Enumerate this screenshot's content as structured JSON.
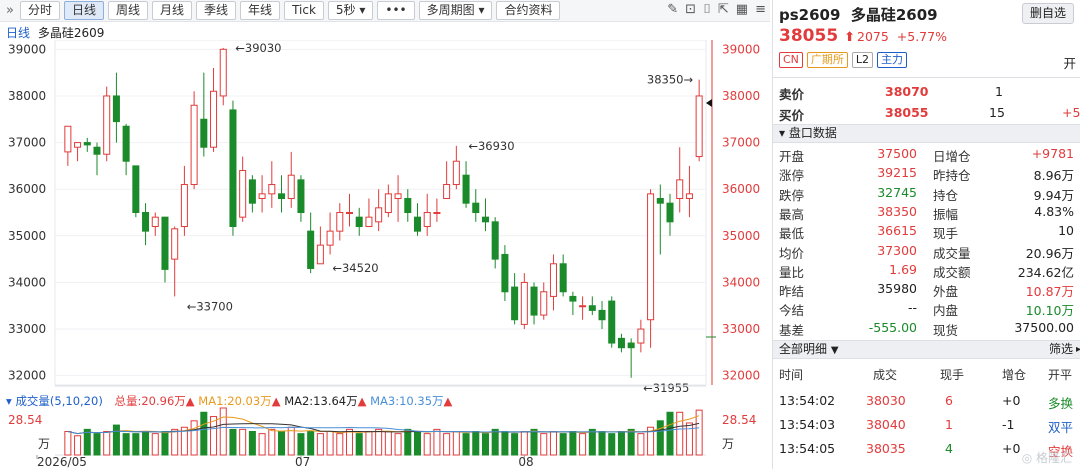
{
  "toolbar": {
    "buttons": [
      "分时",
      "日线",
      "周线",
      "月线",
      "季线",
      "年线",
      "Tick",
      "5秒 ▾",
      "•••",
      "多周期图 ▾",
      "合约资料"
    ],
    "active": 1,
    "left_icon": "collapse-icon"
  },
  "chart_header": {
    "period": "日线",
    "name": "多晶硅2609"
  },
  "chart_data": [
    {
      "type": "candlestick",
      "title": "",
      "y_ticks": [
        39000,
        38000,
        37000,
        36000,
        35000,
        34000,
        33000,
        32000
      ],
      "ylim": [
        31800,
        39200
      ],
      "x_ticks": [
        "2026/05",
        "07",
        "08"
      ],
      "up_color": "#e23b3b",
      "down_color": "#1a8a2a",
      "annotations": [
        {
          "text": "39030",
          "value": 39030
        },
        {
          "text": "33700",
          "value": 33700
        },
        {
          "text": "34520",
          "value": 34520
        },
        {
          "text": "36930",
          "value": 36930
        },
        {
          "text": "38350",
          "value": 38350
        },
        {
          "text": "31955",
          "value": 31955
        }
      ],
      "candles": [
        [
          36800,
          37350,
          36900,
          36500
        ],
        [
          36900,
          37000,
          37000,
          36600
        ],
        [
          37000,
          36950,
          37100,
          36800
        ],
        [
          36900,
          36750,
          37000,
          36300
        ],
        [
          36750,
          38000,
          38200,
          36600
        ],
        [
          38000,
          37450,
          38500,
          37000
        ],
        [
          37350,
          36600,
          37400,
          36300
        ],
        [
          36500,
          35500,
          36500,
          35400
        ],
        [
          35500,
          35100,
          35700,
          34800
        ],
        [
          35200,
          35400,
          35500,
          35000
        ],
        [
          35400,
          34280,
          35400,
          34000
        ],
        [
          34500,
          35150,
          35200,
          33700
        ],
        [
          35200,
          36100,
          36500,
          35000
        ],
        [
          36100,
          37800,
          38100,
          36000
        ],
        [
          37500,
          36900,
          38500,
          36700
        ],
        [
          36900,
          38100,
          38600,
          36800
        ],
        [
          38000,
          39000,
          39030,
          37800
        ],
        [
          37700,
          35200,
          37900,
          35000
        ],
        [
          35400,
          36400,
          36700,
          35300
        ],
        [
          36200,
          35700,
          36300,
          35500
        ],
        [
          35800,
          35900,
          36300,
          35500
        ],
        [
          35900,
          36100,
          36600,
          35600
        ],
        [
          35900,
          35800,
          36300,
          35500
        ],
        [
          35800,
          36300,
          36800,
          35600
        ],
        [
          36200,
          35500,
          36300,
          35300
        ],
        [
          35100,
          34300,
          35500,
          34200
        ],
        [
          34400,
          34800,
          35200,
          34520
        ],
        [
          34800,
          35100,
          35500,
          34600
        ],
        [
          35100,
          35500,
          35700,
          34900
        ],
        [
          35500,
          35500,
          35900,
          35200
        ],
        [
          35400,
          35200,
          35600,
          35000
        ],
        [
          35200,
          35400,
          35800,
          35200
        ],
        [
          35300,
          35600,
          36000,
          35100
        ],
        [
          35500,
          35900,
          36100,
          35400
        ],
        [
          35800,
          35900,
          36300,
          35300
        ],
        [
          35800,
          35500,
          36000,
          35300
        ],
        [
          35400,
          35100,
          35700,
          35000
        ],
        [
          35200,
          35500,
          35900,
          35000
        ],
        [
          35500,
          35500,
          35800,
          35300
        ],
        [
          35800,
          36100,
          36600,
          35800
        ],
        [
          36100,
          36600,
          36930,
          36000
        ],
        [
          36300,
          35700,
          36600,
          35600
        ],
        [
          35700,
          35500,
          36000,
          35300
        ],
        [
          35400,
          35300,
          35800,
          35100
        ],
        [
          35300,
          34500,
          35400,
          34300
        ],
        [
          34600,
          33800,
          34800,
          33600
        ],
        [
          33900,
          33200,
          34200,
          33100
        ],
        [
          33100,
          34000,
          34200,
          33000
        ],
        [
          33900,
          33300,
          34000,
          33100
        ],
        [
          33300,
          33800,
          34000,
          33200
        ],
        [
          33700,
          34400,
          34600,
          33400
        ],
        [
          34400,
          33800,
          34600,
          33700
        ],
        [
          33700,
          33600,
          33800,
          33300
        ],
        [
          33500,
          33500,
          33700,
          33200
        ],
        [
          33500,
          33400,
          33700,
          33300
        ],
        [
          33400,
          33200,
          33600,
          33000
        ],
        [
          33600,
          32700,
          33700,
          32600
        ],
        [
          32800,
          32600,
          32900,
          32500
        ],
        [
          32700,
          32600,
          32800,
          31955
        ],
        [
          32700,
          33000,
          33200,
          32500
        ],
        [
          33200,
          35900,
          36000,
          32600
        ],
        [
          35800,
          35700,
          36100,
          34600
        ],
        [
          35700,
          35300,
          35900,
          35000
        ],
        [
          35800,
          36200,
          36900,
          35500
        ],
        [
          35800,
          35900,
          36500,
          35400
        ],
        [
          36700,
          38000,
          38350,
          36600
        ]
      ]
    },
    {
      "type": "bar",
      "title": "成交量(5,10,20)",
      "y_ticks": [
        "28.54",
        "万"
      ],
      "values": [
        11,
        9,
        12,
        10,
        11,
        14,
        10,
        10,
        11,
        10,
        11,
        12,
        13,
        16,
        20,
        18,
        22,
        12,
        12,
        11,
        10,
        12,
        11,
        13,
        10,
        11,
        10,
        11,
        10,
        12,
        10,
        11,
        12,
        11,
        10,
        12,
        11,
        10,
        12,
        10,
        11,
        10,
        11,
        10,
        12,
        11,
        10,
        11,
        12,
        10,
        11,
        10,
        11,
        10,
        12,
        11,
        10,
        11,
        12,
        10,
        13,
        16,
        20,
        20,
        15,
        21
      ],
      "unit": "万"
    }
  ],
  "volume_legend": {
    "name": "成交量(5,10,20)",
    "total": "总量:20.96万",
    "ma1": "MA1:20.03万",
    "ma2": "MA2:13.64万",
    "ma3": "MA3:10.35万",
    "colors": {
      "total": "#e23b3b",
      "ma1": "#e89a1e",
      "ma2": "#333333",
      "ma3": "#4a8fd6"
    }
  },
  "quote": {
    "symbol": "ps2609",
    "name": "多晶硅2609",
    "last": "38055",
    "arrow": "⬆",
    "change": "2075",
    "pct": "+5.77%",
    "button": "删自选",
    "tags": [
      "CN",
      "广期所",
      "L2",
      "主力"
    ],
    "open_label": "开"
  },
  "orderbook": {
    "sell_label": "卖价",
    "sell_price": "38070",
    "sell_qty": "1",
    "buy_label": "买价",
    "buy_price": "38055",
    "buy_qty": "15",
    "buy_diff": "+5"
  },
  "stats_title": "盘口数据",
  "stats": [
    [
      "开盘",
      "37500",
      "日增仓",
      "+9781"
    ],
    [
      "涨停",
      "39215",
      "昨持仓",
      "8.96万"
    ],
    [
      "跌停",
      "32745",
      "持仓",
      "9.94万"
    ],
    [
      "最高",
      "38350",
      "振幅",
      "4.83%"
    ],
    [
      "最低",
      "36615",
      "现手",
      "10"
    ],
    [
      "均价",
      "37300",
      "成交量",
      "20.96万"
    ],
    [
      "量比",
      "1.69",
      "成交额",
      "234.62亿"
    ],
    [
      "昨结",
      "35980",
      "外盘",
      "10.87万"
    ],
    [
      "今结",
      "--",
      "内盘",
      "10.10万"
    ],
    [
      "基差",
      "-555.00",
      "现货",
      "37500.00"
    ]
  ],
  "trades_title": "全部明细",
  "trades_filter": "筛选",
  "trades_headers": [
    "时间",
    "成交",
    "现手",
    "增仓",
    "开平"
  ],
  "trades": [
    [
      "13:54:02",
      "38030",
      "6",
      "+0",
      "多换"
    ],
    [
      "13:54:03",
      "38040",
      "1",
      "-1",
      "双平"
    ],
    [
      "13:54:05",
      "38035",
      "4",
      "+0",
      "空换"
    ]
  ]
}
